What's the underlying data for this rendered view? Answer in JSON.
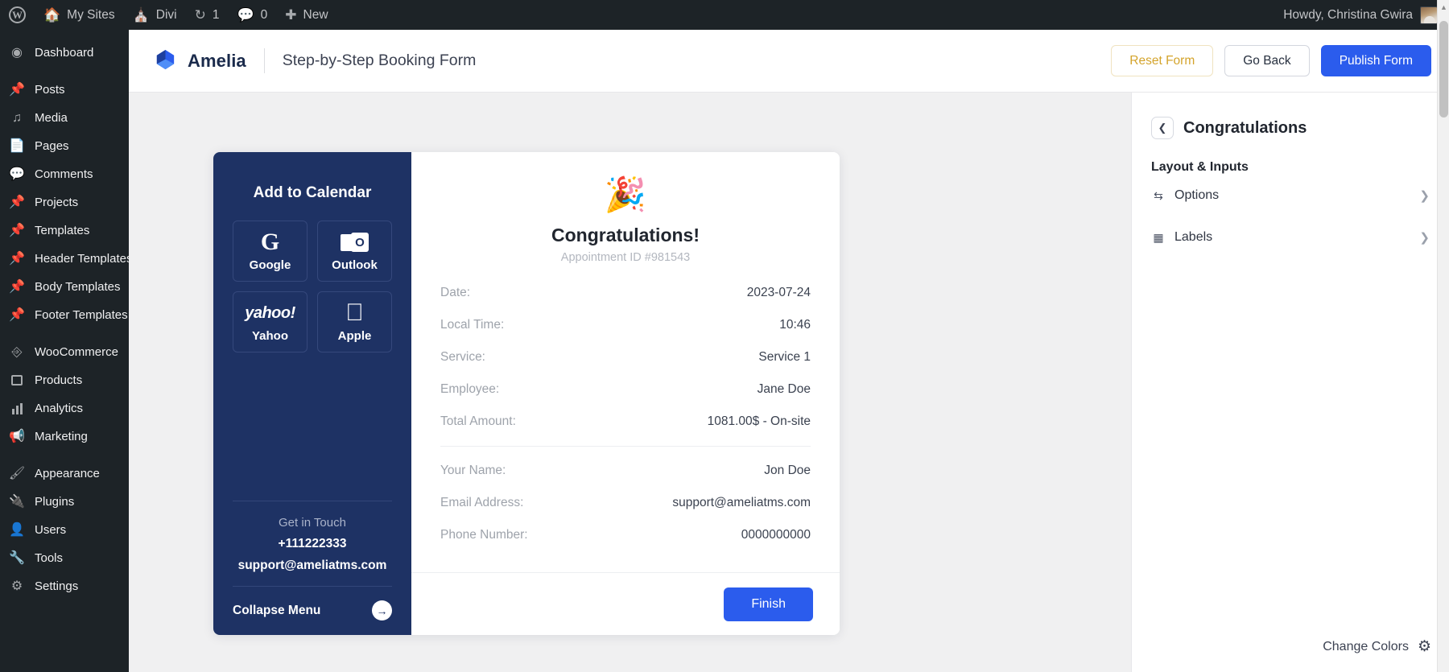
{
  "adminbar": {
    "items": [
      {
        "icon": "wordpress-logo-icon",
        "label": ""
      },
      {
        "icon": "sites-icon",
        "label": "My Sites"
      },
      {
        "icon": "home-icon",
        "label": "Divi"
      },
      {
        "icon": "updates-icon",
        "label": "1"
      },
      {
        "icon": "comment-icon",
        "label": "0"
      },
      {
        "icon": "plus-icon",
        "label": "New"
      }
    ],
    "howdy": "Howdy, Christina Gwira"
  },
  "sidebar": {
    "items": [
      {
        "label": "Dashboard",
        "icon": "dashboard-icon"
      },
      {
        "label": "Posts",
        "icon": "pin-icon"
      },
      {
        "label": "Media",
        "icon": "media-icon"
      },
      {
        "label": "Pages",
        "icon": "pages-icon"
      },
      {
        "label": "Comments",
        "icon": "comment-icon"
      },
      {
        "label": "Projects",
        "icon": "pin-icon"
      },
      {
        "label": "Templates",
        "icon": "pin-icon"
      },
      {
        "label": "Header Templates",
        "icon": "pin-icon"
      },
      {
        "label": "Body Templates",
        "icon": "pin-icon"
      },
      {
        "label": "Footer Templates",
        "icon": "pin-icon"
      },
      {
        "label": "WooCommerce",
        "icon": "woo-icon"
      },
      {
        "label": "Products",
        "icon": "products-icon"
      },
      {
        "label": "Analytics",
        "icon": "analytics-icon"
      },
      {
        "label": "Marketing",
        "icon": "megaphone-icon"
      },
      {
        "label": "Appearance",
        "icon": "brush-icon"
      },
      {
        "label": "Plugins",
        "icon": "plug-icon"
      },
      {
        "label": "Users",
        "icon": "user-icon"
      },
      {
        "label": "Tools",
        "icon": "wrench-icon"
      },
      {
        "label": "Settings",
        "icon": "settings-icon"
      }
    ]
  },
  "header": {
    "brand": "Amelia",
    "title": "Step-by-Step Booking Form",
    "reset_label": "Reset Form",
    "goback_label": "Go Back",
    "publish_label": "Publish Form",
    "accent_blue": "#2b5ced",
    "accent_gold": "#d4a42c"
  },
  "form": {
    "side_panel": {
      "title": "Add to Calendar",
      "calendar_buttons": [
        {
          "label": "Google",
          "icon": "google-logo-icon"
        },
        {
          "label": "Outlook",
          "icon": "outlook-logo-icon"
        },
        {
          "label": "Yahoo",
          "icon": "yahoo-logo-icon"
        },
        {
          "label": "Apple",
          "icon": "apple-logo-icon"
        }
      ],
      "contact_label": "Get in Touch",
      "phone": "+111222333",
      "email": "support@ameliatms.com",
      "collapse_label": "Collapse Menu",
      "panel_color": "#1e3264"
    },
    "heading": "Congratulations!",
    "appointment_id": "Appointment ID #981543",
    "confetti_icon": "party-popper-icon",
    "details": [
      {
        "label": "Date:",
        "value": "2023-07-24"
      },
      {
        "label": "Local Time:",
        "value": "10:46"
      },
      {
        "label": "Service:",
        "value": "Service 1"
      },
      {
        "label": "Employee:",
        "value": "Jane Doe"
      },
      {
        "label": "Total Amount:",
        "value": "1081.00$ - On-site"
      }
    ],
    "customer": [
      {
        "label": "Your Name:",
        "value": "Jon Doe"
      },
      {
        "label": "Email Address:",
        "value": "support@ameliatms.com"
      },
      {
        "label": "Phone Number:",
        "value": "0000000000"
      }
    ],
    "finish_label": "Finish"
  },
  "config": {
    "title": "Congratulations",
    "back_icon": "chevron-left-icon",
    "subtitle": "Layout & Inputs",
    "rows": [
      {
        "label": "Options",
        "icon": "sliders-icon",
        "chevron": "chevron-right-icon"
      },
      {
        "label": "Labels",
        "icon": "tag-icon",
        "chevron": "chevron-right-icon"
      }
    ],
    "change_colors": "Change Colors",
    "gear_icon": "gear-icon"
  }
}
